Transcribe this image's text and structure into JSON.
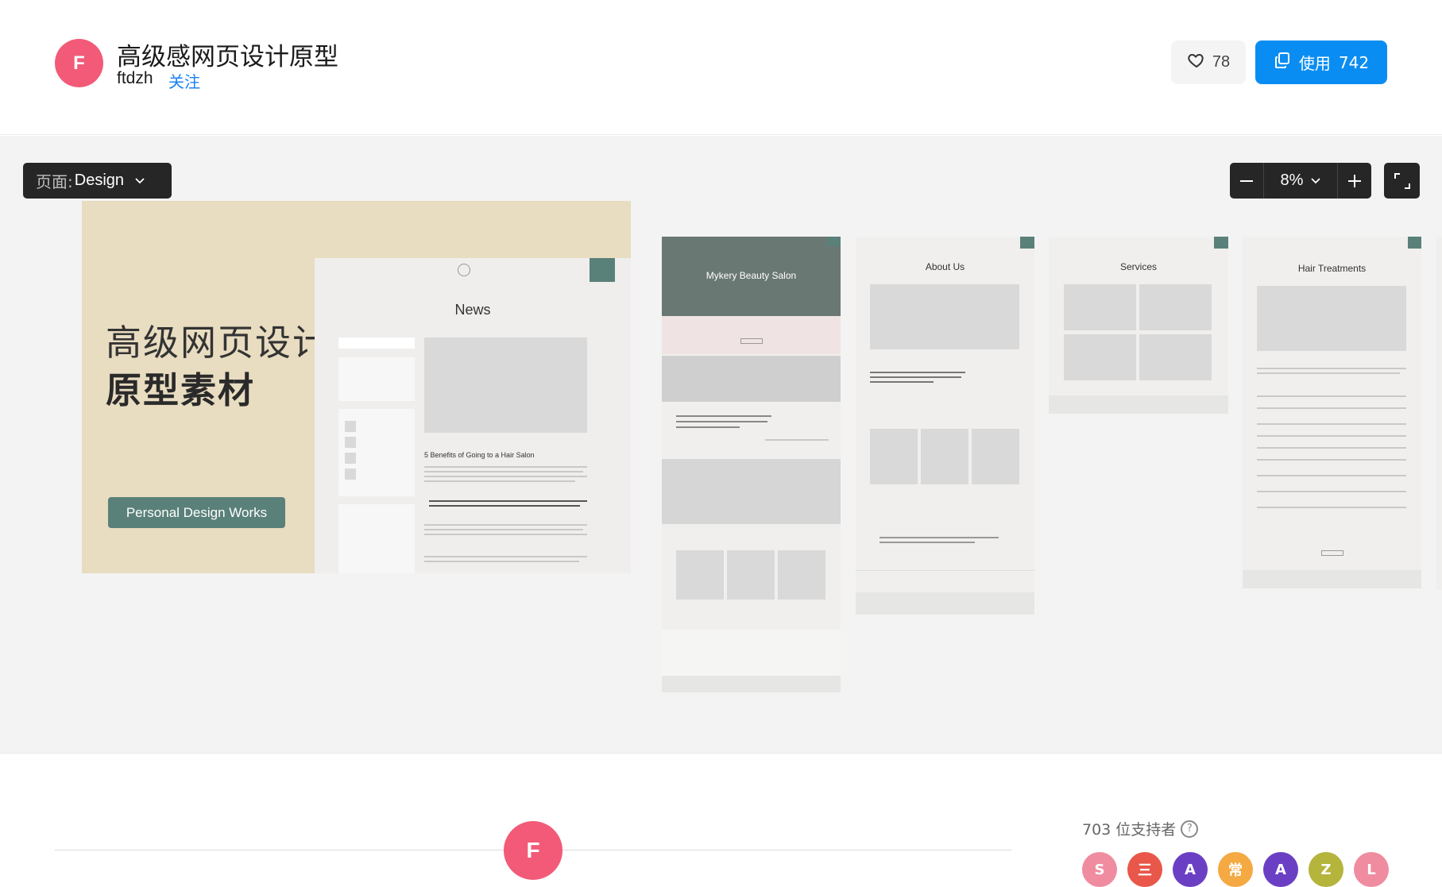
{
  "header": {
    "author_initial": "F",
    "title": "高级感网页设计原型",
    "author": "ftdzh",
    "follow_label": "关注",
    "likes": "78",
    "use_label": "使用",
    "use_count": "742"
  },
  "canvas": {
    "page_prefix": "页面:",
    "page_name": "Design",
    "zoom": "8%",
    "cover": {
      "line1": "高级网页设计",
      "line2": "原型素材",
      "badge": "Personal Design Works",
      "news_title": "News",
      "news_subtitle": "5 Benefits of Going to a Hair Salon"
    },
    "frames": [
      {
        "title": "Mykery Beauty Salon"
      },
      {
        "title": "About Us"
      },
      {
        "title": "Services"
      },
      {
        "title": "Hair Treatments"
      }
    ]
  },
  "footer": {
    "author_initial": "F",
    "supporters_label": "703 位支持者",
    "supporters": [
      {
        "initial": "S",
        "color": "#f08ca0"
      },
      {
        "initial": "三",
        "color": "#e8574a"
      },
      {
        "initial": "A",
        "color": "#6b3fc4"
      },
      {
        "initial": "常",
        "color": "#f5a942"
      },
      {
        "initial": "A",
        "color": "#6b3fc4"
      },
      {
        "initial": "Z",
        "color": "#b5b43c"
      },
      {
        "initial": "L",
        "color": "#f08ca0"
      }
    ]
  },
  "colors": {
    "accent": "#0a8df2",
    "brand_avatar": "#f25a78",
    "teal": "#5a8179",
    "cover_bg": "#e8dcc1"
  }
}
